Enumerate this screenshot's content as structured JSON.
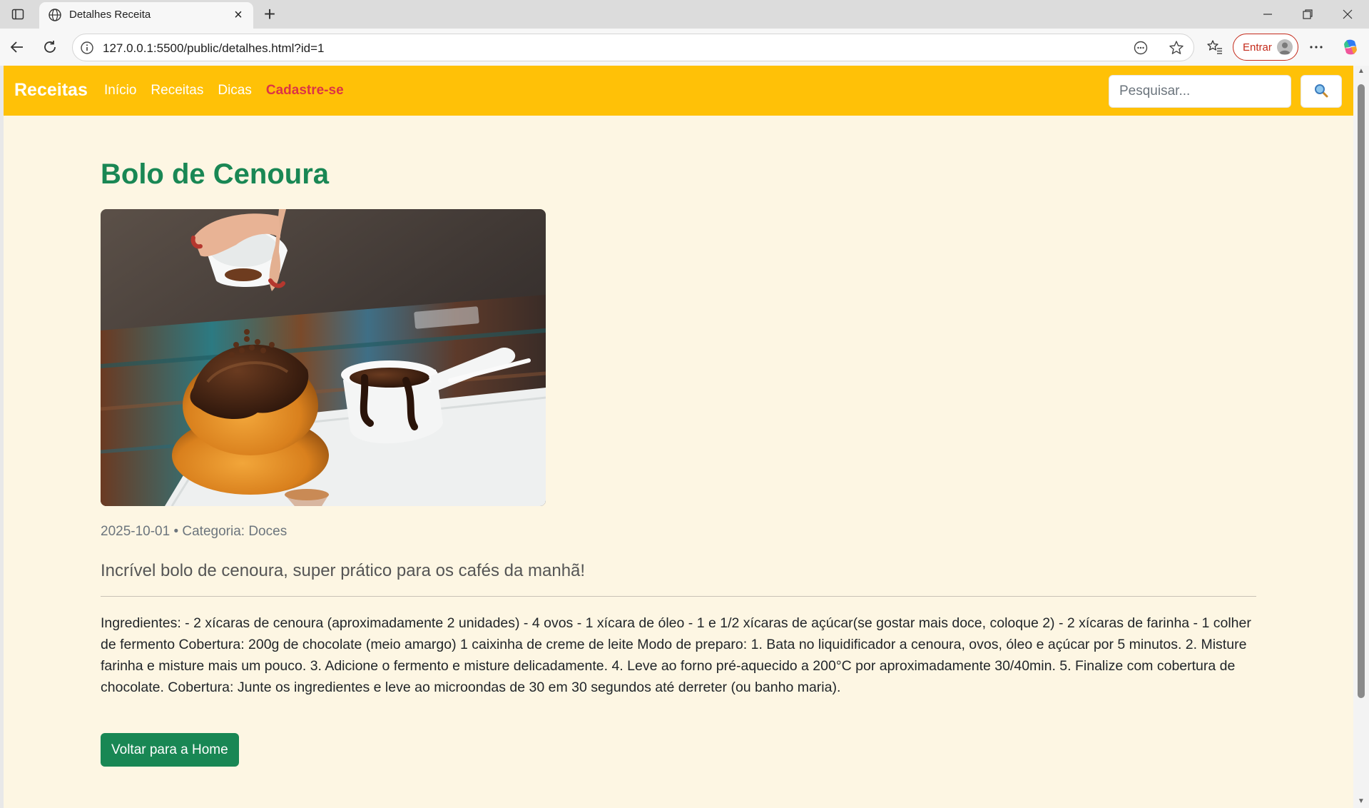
{
  "browser": {
    "tab_title": "Detalhes Receita",
    "url": "127.0.0.1:5500/public/detalhes.html?id=1",
    "signin_label": "Entrar"
  },
  "navbar": {
    "brand": "Receitas",
    "links": [
      "Início",
      "Receitas",
      "Dicas"
    ],
    "cta": "Cadastre-se",
    "search_placeholder": "Pesquisar..."
  },
  "recipe": {
    "title": "Bolo de Cenoura",
    "meta": "2025-10-01 • Categoria: Doces",
    "lead": "Incrível bolo de cenoura, super prático para os cafés da manhã!",
    "body": "Ingredientes: - 2 xícaras de cenoura (aproximadamente 2 unidades) - 4 ovos - 1 xícara de óleo - 1 e 1/2 xícaras de açúcar(se gostar mais doce, coloque 2) - 2 xícaras de farinha - 1 colher de fermento Cobertura: 200g de chocolate (meio amargo) 1 caixinha de creme de leite Modo de preparo: 1. Bata no liquidificador a cenoura, ovos, óleo e açúcar por 5 minutos. 2. Misture farinha e misture mais um pouco. 3. Adicione o fermento e misture delicadamente. 4. Leve ao forno pré-aquecido a 200°C por aproximadamente 30/40min. 5. Finalize com cobertura de chocolate. Cobertura: Junte os ingredientes e leve ao microondas de 30 em 30 segundos até derreter (ou banho maria).",
    "back_button": "Voltar para a Home"
  },
  "colors": {
    "navbar_bg": "#ffc107",
    "title_green": "#198754",
    "cta_red": "#dc3545",
    "page_bg": "#fdf6e3"
  }
}
